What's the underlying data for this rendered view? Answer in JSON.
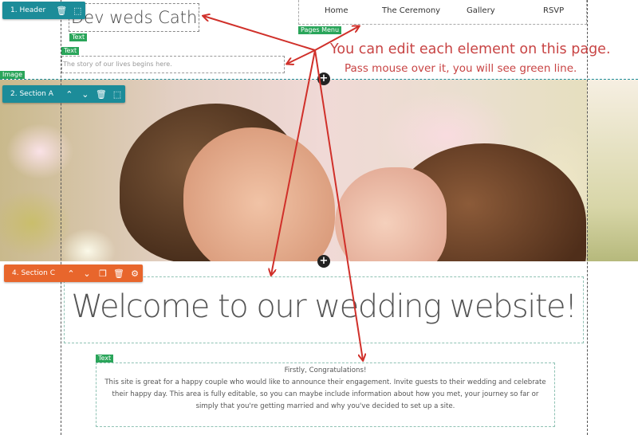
{
  "header": {
    "site_title": "Dev weds Cathy",
    "title_tag": "Text",
    "tagline_tag": "Text",
    "tagline": "The story of our lives begins here.",
    "image_tag": "Image",
    "menu_tag": "Pages Menu",
    "menu_items": [
      {
        "label": "Home"
      },
      {
        "label": "The Ceremony"
      },
      {
        "label": "Gallery"
      },
      {
        "label": "RSVP"
      }
    ]
  },
  "toolbars": {
    "header": {
      "label": "1. Header",
      "icons": [
        "trash-icon",
        "select-icon"
      ]
    },
    "section_a": {
      "label": "2. Section A",
      "icons": [
        "chevron-up-icon",
        "chevron-down-icon",
        "trash-icon",
        "select-icon"
      ]
    },
    "section_c": {
      "label": "4. Section C",
      "icons": [
        "chevron-up-icon",
        "chevron-down-icon",
        "duplicate-icon",
        "trash-icon",
        "gear-icon"
      ]
    }
  },
  "glyphs": {
    "trash": "🗑",
    "select": "⬚",
    "up": "⌃",
    "down": "⌄",
    "duplicate": "❐",
    "gear": "⚙",
    "plus": "+"
  },
  "colors": {
    "teal_toolbar": "#1c8c99",
    "orange_toolbar": "#e8662c",
    "tag_green": "#2aa55a",
    "annotation_red": "#c84444"
  },
  "annotation": {
    "line1": "You can edit each element on this page.",
    "line2": "Pass mouse over it, you will see green line."
  },
  "section_c": {
    "heading": "Welcome to our wedding website!",
    "text_tag": "Text",
    "body_title": "Firstly, Congratulations!",
    "body_lines": [
      "This site is great for a happy couple who would like to announce their engagement. Invite guests to their wedding and celebrate",
      "their happy day. This area is fully editable, so you can maybe include information about how you met, your journey so far or",
      "simply that you're getting married and why you've decided to set up a site."
    ]
  }
}
